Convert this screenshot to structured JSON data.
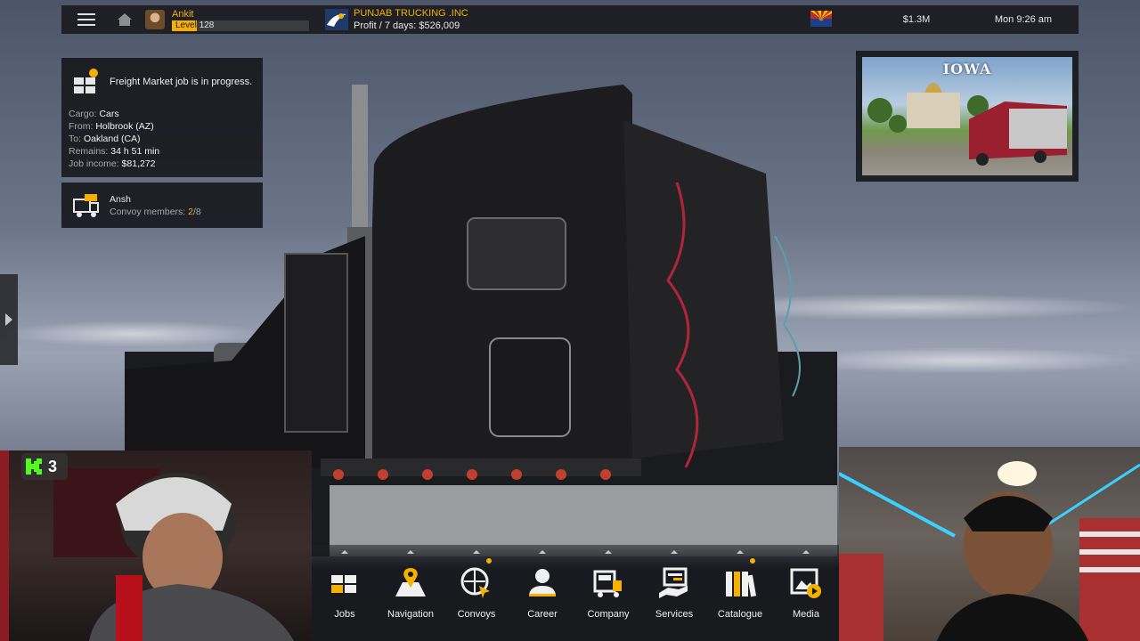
{
  "topbar": {
    "player_name": "Ankit",
    "level_label": "Level",
    "level_value": "128",
    "level_progress": 0.18,
    "company_name": "PUNJAB TRUCKING .INC",
    "profit": "Profit / 7 days: $526,009",
    "money": "$1.3M",
    "time": "Mon 9:26 am"
  },
  "job": {
    "message": "Freight Market job is in progress.",
    "cargo_label": "Cargo:",
    "cargo": "Cars",
    "from_label": "From:",
    "from": "Holbrook (AZ)",
    "to_label": "To:",
    "to": "Oakland (CA)",
    "remains_label": "Remains:",
    "remains": "34 h 51 min",
    "income_label": "Job income:",
    "income": "$81,272"
  },
  "convoy": {
    "name": "Ansh",
    "members_label": "Convoy members:",
    "members_current": "2",
    "members_total": "/8"
  },
  "news": {
    "title": "IOWA"
  },
  "dock": {
    "items": [
      {
        "label": "Jobs",
        "icon": "jobs-icon",
        "notify": false
      },
      {
        "label": "Navigation",
        "icon": "navigation-icon",
        "notify": false
      },
      {
        "label": "Convoys",
        "icon": "convoys-icon",
        "notify": true
      },
      {
        "label": "Career",
        "icon": "career-icon",
        "notify": false
      },
      {
        "label": "Company",
        "icon": "company-icon",
        "notify": false
      },
      {
        "label": "Services",
        "icon": "services-icon",
        "notify": false
      },
      {
        "label": "Catalogue",
        "icon": "catalogue-icon",
        "notify": true
      },
      {
        "label": "Media",
        "icon": "media-icon",
        "notify": false
      }
    ]
  },
  "kick": {
    "count": "3"
  },
  "colors": {
    "accent": "#f5b000",
    "panel": "#181a1e"
  }
}
